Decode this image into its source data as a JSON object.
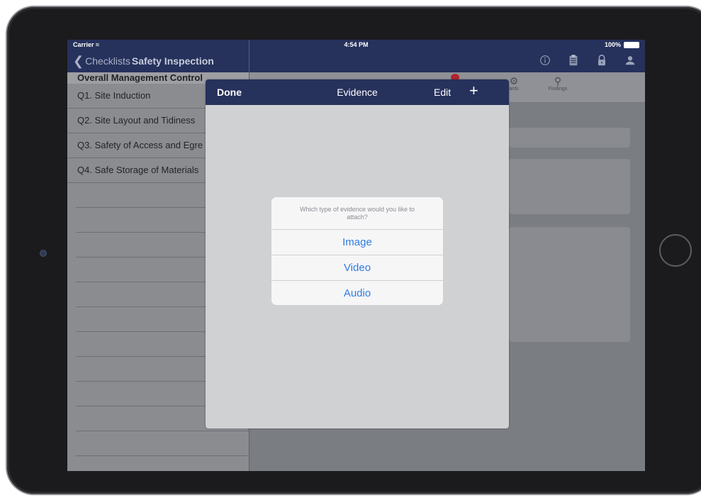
{
  "status": {
    "carrier": "Carrier",
    "time": "4:54 PM",
    "battery": "100%"
  },
  "nav": {
    "back_label": "Checklists",
    "title": "Safety Inspection",
    "icons": [
      "info-icon",
      "clipboard-icon",
      "lock-icon",
      "user-icon"
    ]
  },
  "left": {
    "section_header": "Overall Management Control",
    "items": [
      {
        "label": "Q1. Site Induction"
      },
      {
        "label": "Q2. Site Layout and Tidiness"
      },
      {
        "label": "Q3. Safety of Access and Egre"
      },
      {
        "label": "Q4. Safe Storage of Materials"
      }
    ]
  },
  "tabs": {
    "labels": [
      "ards",
      "Findings"
    ]
  },
  "modal": {
    "done": "Done",
    "title": "Evidence",
    "edit": "Edit",
    "add": "+"
  },
  "alert": {
    "message": "Which type of evidence would you like to attach?",
    "options": [
      "Image",
      "Video",
      "Audio"
    ]
  },
  "colors": {
    "nav_bar": "#26315c",
    "alert_button": "#2f7be5",
    "badge": "#b1242c"
  }
}
